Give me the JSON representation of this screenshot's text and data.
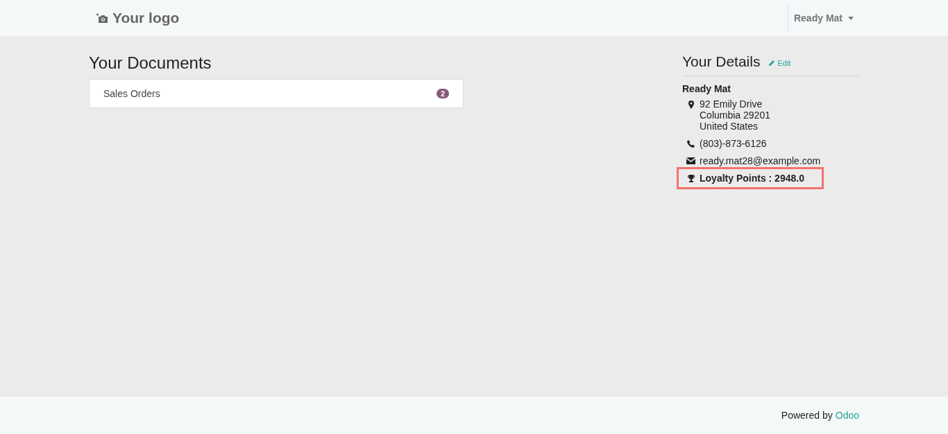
{
  "header": {
    "logo": "Your logo",
    "user_menu": "Ready Mat"
  },
  "documents": {
    "title": "Your Documents",
    "items": [
      {
        "label": "Sales Orders",
        "count": "2"
      }
    ]
  },
  "details": {
    "title": "Your Details",
    "edit_link": "Edit",
    "name": "Ready Mat",
    "items": [
      {
        "kind": "address",
        "lines": [
          "92 Emily Drive",
          "Columbia 29201",
          "United States"
        ],
        "highlighted": false
      },
      {
        "kind": "phone",
        "lines": [
          "(803)-873-6126"
        ],
        "highlighted": false
      },
      {
        "kind": "email",
        "lines": [
          "ready.mat28@example.com"
        ],
        "highlighted": false
      },
      {
        "kind": "loyalty",
        "lines": [
          "Loyalty Points : 2948.0"
        ],
        "highlighted": true
      }
    ]
  },
  "footer": {
    "powered_by": "Powered by",
    "brand": "Odoo"
  }
}
